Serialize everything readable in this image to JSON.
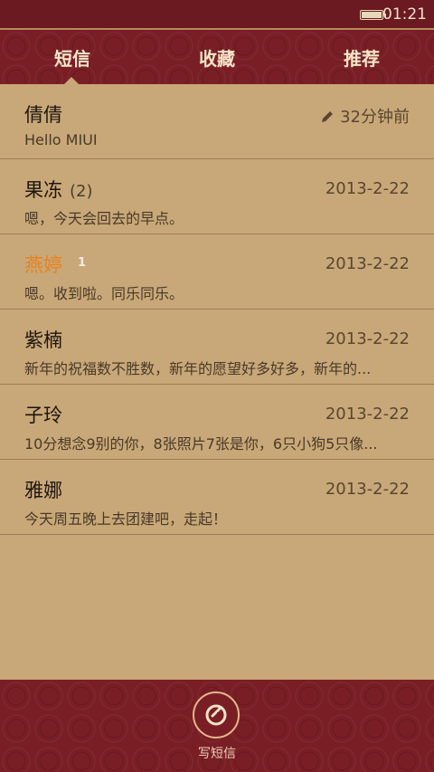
{
  "status": {
    "time": "01:21"
  },
  "tabs": [
    {
      "label": "短信"
    },
    {
      "label": "收藏"
    },
    {
      "label": "推荐"
    }
  ],
  "messages": [
    {
      "name": "倩倩",
      "count": "",
      "badge": "",
      "time": "32分钟前",
      "preview": "Hello MIUI",
      "has_draft_icon": true,
      "unread": false
    },
    {
      "name": "果冻",
      "count": "(2)",
      "badge": "",
      "time": "2013-2-22",
      "preview": "嗯，今天会回去的早点。",
      "unread": false
    },
    {
      "name": "燕婷",
      "count": "",
      "badge": "1",
      "time": "2013-2-22",
      "preview": "嗯。收到啦。同乐同乐。",
      "unread": true
    },
    {
      "name": "紫楠",
      "count": "",
      "badge": "",
      "time": "2013-2-22",
      "preview": "新年的祝福数不胜数，新年的愿望好多好多，新年的...",
      "unread": false
    },
    {
      "name": "子玲",
      "count": "",
      "badge": "",
      "time": "2013-2-22",
      "preview": "10分想念9别的你，8张照片7张是你，6只小狗5只像...",
      "unread": false
    },
    {
      "name": "雅娜",
      "count": "",
      "badge": "",
      "time": "2013-2-22",
      "preview": "今天周五晚上去团建吧，走起！",
      "unread": false
    }
  ],
  "compose": {
    "label": "写短信"
  },
  "colors": {
    "header": "#7a1e26",
    "list_bg": "#c8a878",
    "unread": "#e8821e"
  }
}
